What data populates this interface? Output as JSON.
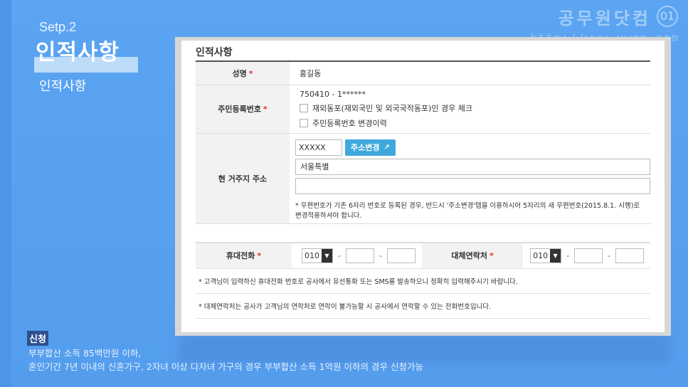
{
  "slide": {
    "step": "Setp.2",
    "title": "인적사항",
    "subtitle": "인적사항",
    "watermark": "공무원닷컴",
    "watermark_url": "http://www.uwon.com",
    "watermark_logo": "01"
  },
  "form": {
    "heading": "인적사항",
    "name_label": "성명",
    "name_value": "홍길동",
    "ssn_label": "주민등록번호",
    "ssn_value": "750410  - 1******",
    "ssn_check1": "재외동포(재외국민 및 외국국적동포)인 경우 체크",
    "ssn_check2": "주민등록번호 변경이력",
    "address_label": "현 거주지 주소",
    "zip_value": "XXXXX",
    "address_button": "주소변경",
    "address_line1": "서울특별",
    "address_line2": "",
    "address_note": "* 우편번호가 기존 6자리 번호로 등록된 경우, 반드시 '주소변경'탭을 이용하시어 5자리의 새 우편번호(2015.8.1. 시행)로 변경적용하셔야 합니다.",
    "mobile_label": "휴대전화",
    "mobile_prefix": "010",
    "alt_label": "대체연락처",
    "alt_prefix": "010",
    "note1": "* 고객님이 입력하신 휴대전화 번호로 공사에서 유선통화 또는 SMS를 발송하오니 정확히 입력해주시기 바랍니다.",
    "note2": "* 대체연락처는 공사가 고객님의 연락처로 연락이 불가능할 시 공사에서 연락할 수 있는 전화번호입니다."
  },
  "caption": {
    "badge": "신청",
    "line1": "부부합산 소득 85백만원 이하,",
    "line2": "혼인기간 7년 이내의 신혼가구, 2자녀 이상 다자녀 가구의 경우 부부합산 소득 1억원 이하의 경우 신청가능"
  }
}
